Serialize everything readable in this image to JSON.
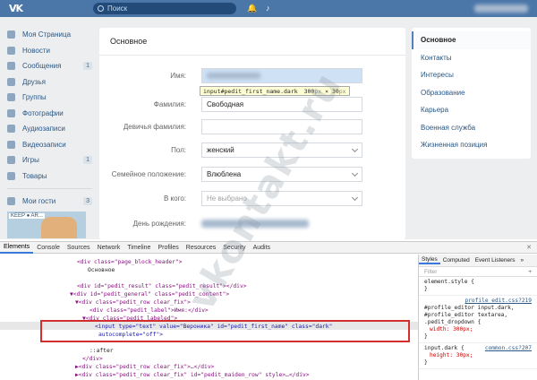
{
  "topbar": {
    "logo": "VK",
    "search_placeholder": "Поиск"
  },
  "sidebar": {
    "items": [
      {
        "label": "Моя Страница",
        "count": ""
      },
      {
        "label": "Новости",
        "count": ""
      },
      {
        "label": "Сообщения",
        "count": "1"
      },
      {
        "label": "Друзья",
        "count": ""
      },
      {
        "label": "Группы",
        "count": ""
      },
      {
        "label": "Фотографии",
        "count": ""
      },
      {
        "label": "Аудиозаписи",
        "count": ""
      },
      {
        "label": "Видеозаписи",
        "count": ""
      },
      {
        "label": "Игры",
        "count": "1"
      },
      {
        "label": "Товары",
        "count": ""
      }
    ],
    "guests_label": "Мои гости",
    "guests_count": "3"
  },
  "main": {
    "title": "Основное",
    "fields": {
      "first_name_label": "Имя:",
      "last_name_label": "Фамилия:",
      "last_name_value": "Свободная",
      "maiden_label": "Девичья фамилия:",
      "gender_label": "Пол:",
      "gender_value": "женский",
      "marital_label": "Семейное положение:",
      "marital_value": "Влюблена",
      "in_whom_label": "В кого:",
      "in_whom_value": "Не выбрано",
      "birthday_label": "День рождения:"
    },
    "tooltip": {
      "selector": "input#pedit_first_name.dark",
      "width": "300",
      "height": "30",
      "unit": "px",
      "times": "×"
    }
  },
  "right_nav": {
    "items": [
      "Основное",
      "Контакты",
      "Интересы",
      "Образование",
      "Карьера",
      "Военная служба",
      "Жизненная позиция"
    ]
  },
  "watermark": "vkontakt.ru",
  "ad": {
    "text": "KEEP ● AR..."
  },
  "devtools": {
    "tabs": [
      "Elements",
      "Console",
      "Sources",
      "Network",
      "Timeline",
      "Profiles",
      "Resources",
      "Security",
      "Audits"
    ],
    "dom": {
      "l1_open": "<div class=\"page_block_header\">",
      "l1_text": "Основное",
      "l2": "<div id=\"pedit_result\" class=\"pedit_result\"></div>",
      "l3": "▼<div id=\"pedit_general\" class=\"pedit_content\">",
      "l4": "▼<div class=\"pedit_row clear_fix\">",
      "l5": "<div class=\"pedit_label\">Имя:</div>",
      "l6": "▼<div class=\"pedit_labeled\">",
      "l7": "<input type=\"text\" value=\"Вероника\" id=\"pedit_first_name\" class=\"dark\"",
      "l8": "autocomplete=\"off\">",
      "l9": "::after",
      "l10": "</div>",
      "l11": "▶<div class=\"pedit_row clear_fix\">…</div>",
      "l12": "▶<div class=\"pedit_row clear_fix\" id=\"pedit_maiden_row\" style>…</div>"
    },
    "styles": {
      "tabs": [
        "Styles",
        "Computed",
        "Event Listeners",
        "»"
      ],
      "filter": "Filter",
      "rule1": "element.style {",
      "rule1_end": "}",
      "rule2_src": "profile_edit.css?219",
      "rule2_sel1": "#profile_editor input.dark,",
      "rule2_sel2": "#profile_editor textarea,",
      "rule2_sel3": ".pedit_dropdown {",
      "rule2_prop": "width: 300px;",
      "rule2_end": "}",
      "rule3_sel": "input.dark {",
      "rule3_src": "common.css?207",
      "rule3_prop": "height: 30px;",
      "rule3_end": "}"
    }
  }
}
